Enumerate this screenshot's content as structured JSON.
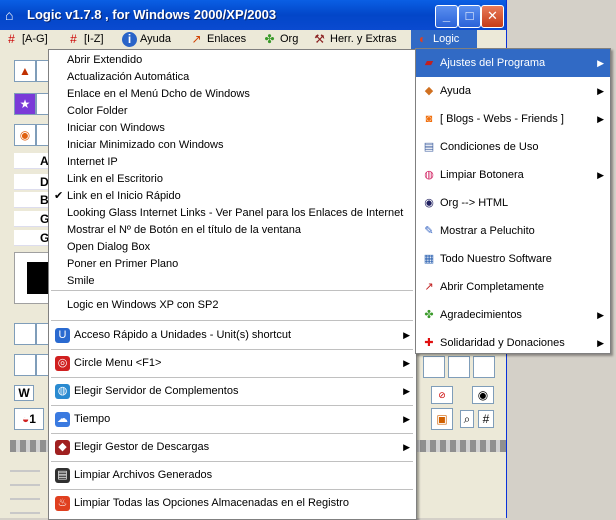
{
  "window": {
    "title": "Logic v1.7.8 , for Windows 2000/XP/2003",
    "controls": {
      "minimize": "_",
      "maximize": "□",
      "close": "✕"
    }
  },
  "menubar": {
    "items": [
      {
        "label": "[A-G]",
        "icon": "hash-icon"
      },
      {
        "label": "[I-Z]",
        "icon": "hash-icon"
      },
      {
        "label": "Ayuda",
        "icon": "info-icon"
      },
      {
        "label": "Enlaces",
        "icon": "links-icon"
      },
      {
        "label": "Org",
        "icon": "puzzle-icon"
      },
      {
        "label": "Herr. y Extras",
        "icon": "tools-icon"
      },
      {
        "label": "Logic",
        "icon": "logic-icon"
      }
    ]
  },
  "left_strip": {
    "list_letters": [
      "A",
      "D",
      "B",
      "G",
      "G"
    ],
    "bottom_labels": [
      "W",
      "1"
    ]
  },
  "main_menu": {
    "items": [
      {
        "label": "Abrir Extendido",
        "checked": false
      },
      {
        "label": "Actualización Automática",
        "checked": false
      },
      {
        "label": "Enlace en el Menú Dcho de Windows",
        "checked": false
      },
      {
        "label": "Color Folder",
        "checked": false
      },
      {
        "label": "Iniciar con Windows",
        "checked": false
      },
      {
        "label": "Iniciar Minimizado con Windows",
        "checked": false
      },
      {
        "label": "Internet IP",
        "checked": false
      },
      {
        "label": "Link en el Escritorio",
        "checked": false
      },
      {
        "label": "Link en el Inicio Rápido",
        "checked": true
      },
      {
        "label": "Looking Glass Internet Links - Ver Panel para los Enlaces de Internet",
        "checked": false
      },
      {
        "label": "Mostrar el Nº de Botón en el título de la ventana",
        "checked": false
      },
      {
        "label": "Open Dialog Box",
        "checked": false
      },
      {
        "label": "Poner en Primer Plano",
        "checked": false
      },
      {
        "label": "Smile",
        "checked": false
      }
    ],
    "xp_item": "Logic en Windows XP con SP2",
    "icon_items": [
      {
        "label": "Acceso Rápido a Unidades - Unit(s) shortcut",
        "icon": "drive-icon",
        "submenu": true
      },
      {
        "label": "Circle Menu    <F1>",
        "icon": "circle-menu-icon",
        "submenu": true
      },
      {
        "label": "Elegir Servidor de Complementos",
        "icon": "server-icon",
        "submenu": true
      },
      {
        "label": "Tiempo",
        "icon": "weather-icon",
        "submenu": true
      },
      {
        "label": "Elegir Gestor de Descargas",
        "icon": "download-manager-icon",
        "submenu": true
      },
      {
        "label": "Limpiar Archivos Generados",
        "icon": "clean-files-icon",
        "submenu": false
      },
      {
        "label": "Limpiar Todas las Opciones Almacenadas en el Registro",
        "icon": "registry-clean-icon",
        "submenu": false
      }
    ],
    "check_glyph": "✔",
    "arrow_glyph": "▶"
  },
  "logic_menu": {
    "items": [
      {
        "label": "Ajustes del Programa",
        "icon": "settings-book-icon",
        "submenu": true,
        "selected": true
      },
      {
        "label": "Ayuda",
        "icon": "help-icon",
        "submenu": true,
        "selected": false
      },
      {
        "label": "[ Blogs - Webs - Friends ]",
        "icon": "rss-icon",
        "submenu": true,
        "selected": false
      },
      {
        "label": "Condiciones de Uso",
        "icon": "terms-icon",
        "submenu": false,
        "selected": false
      },
      {
        "label": "Limpiar Botonera",
        "icon": "clean-buttons-icon",
        "submenu": true,
        "selected": false
      },
      {
        "label": "Org --> HTML",
        "icon": "html-icon",
        "submenu": false,
        "selected": false
      },
      {
        "label": "Mostrar a Peluchito",
        "icon": "mascot-icon",
        "submenu": false,
        "selected": false
      },
      {
        "label": "Todo Nuestro Software",
        "icon": "software-icon",
        "submenu": false,
        "selected": false
      },
      {
        "label": "Abrir Completamente",
        "icon": "open-full-icon",
        "submenu": false,
        "selected": false
      },
      {
        "label": "Agradecimientos",
        "icon": "thanks-icon",
        "submenu": true,
        "selected": false
      },
      {
        "label": "Solidaridad y Donaciones",
        "icon": "red-cross-icon",
        "submenu": true,
        "selected": false
      }
    ]
  },
  "colors": {
    "titlebar": "#0a5fe4",
    "selection": "#316ac5",
    "window_bg": "#ece9d8"
  }
}
